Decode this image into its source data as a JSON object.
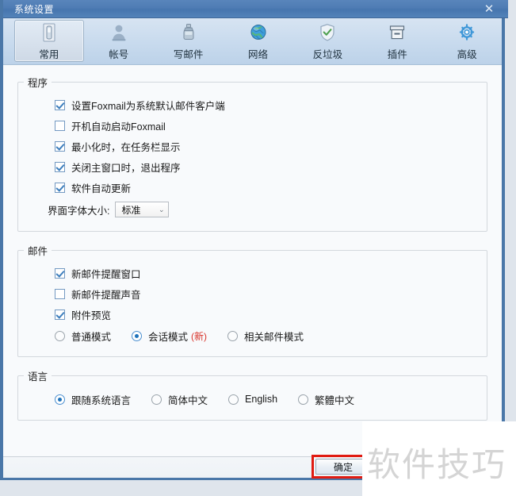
{
  "window": {
    "title": "系统设置",
    "close_label": "✕"
  },
  "toolbar": {
    "tabs": [
      {
        "label": "常用",
        "icon": "general-icon",
        "active": true
      },
      {
        "label": "帐号",
        "icon": "account-icon",
        "active": false
      },
      {
        "label": "写邮件",
        "icon": "compose-icon",
        "active": false
      },
      {
        "label": "网络",
        "icon": "network-icon",
        "active": false
      },
      {
        "label": "反垃圾",
        "icon": "antispam-icon",
        "active": false
      },
      {
        "label": "插件",
        "icon": "plugin-icon",
        "active": false
      },
      {
        "label": "高级",
        "icon": "advanced-icon",
        "active": false
      }
    ]
  },
  "program_group": {
    "legend": "程序",
    "checkboxes": [
      {
        "label": "设置Foxmail为系统默认邮件客户端",
        "checked": true
      },
      {
        "label": "开机自动启动Foxmail",
        "checked": false
      },
      {
        "label": "最小化时，在任务栏显示",
        "checked": true
      },
      {
        "label": "关闭主窗口时，退出程序",
        "checked": true
      },
      {
        "label": "软件自动更新",
        "checked": true
      }
    ],
    "font_size_label": "界面字体大小:",
    "font_size_value": "标准",
    "font_size_chevron": "⌄"
  },
  "mail_group": {
    "legend": "邮件",
    "checkboxes": [
      {
        "label": "新邮件提醒窗口",
        "checked": true
      },
      {
        "label": "新邮件提醒声音",
        "checked": false
      },
      {
        "label": "附件预览",
        "checked": true
      }
    ],
    "modes": [
      {
        "label": "普通模式",
        "checked": false,
        "badge": ""
      },
      {
        "label": "会话模式",
        "checked": true,
        "badge": "(新)"
      },
      {
        "label": "相关邮件模式",
        "checked": false,
        "badge": ""
      }
    ]
  },
  "language_group": {
    "legend": "语言",
    "options": [
      {
        "label": "跟随系统语言",
        "checked": true
      },
      {
        "label": "简体中文",
        "checked": false
      },
      {
        "label": "English",
        "checked": false
      },
      {
        "label": "繁體中文",
        "checked": false
      }
    ]
  },
  "footer": {
    "ok_label": "确定"
  },
  "overlay": {
    "watermark": "软件技巧"
  },
  "colors": {
    "titlebar": "#4f7cb4",
    "frame_border": "#4a77a8",
    "accent_check": "#3d7ebd",
    "accent_radio": "#1f73bb",
    "badge_red": "#d9342b",
    "highlight_red": "#e01b12",
    "content_bg": "#f8fafc"
  }
}
